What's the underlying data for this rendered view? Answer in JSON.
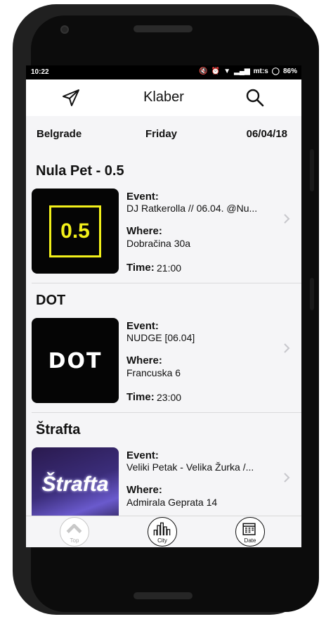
{
  "status_bar": {
    "time": "10:22",
    "carrier": "mt:s",
    "battery": "86%"
  },
  "header": {
    "title": "Klaber",
    "left_icon": "send-icon",
    "right_icon": "search-icon"
  },
  "filters": {
    "city": "Belgrade",
    "day": "Friday",
    "date": "06/04/18"
  },
  "labels": {
    "event": "Event:",
    "where": "Where:",
    "time": "Time:"
  },
  "venues": [
    {
      "name": "Nula Pet - 0.5",
      "logo_text": "0.5",
      "event": "DJ Ratkerolla // 06.04. @Nu...",
      "where": "Dobračina 30a",
      "time": "21:00"
    },
    {
      "name": "DOT",
      "logo_text": "DOT",
      "event": "NUDGE [06.04]",
      "where": "Francuska 6",
      "time": "23:00"
    },
    {
      "name": "Štrafta",
      "logo_text": "Štrafta",
      "event": "Veliki Petak - Velika Žurka /...",
      "where": "Admirala Geprata 14"
    }
  ],
  "tabbar": [
    {
      "label": "Top",
      "icon": "arrow-up-icon"
    },
    {
      "label": "City",
      "icon": "city-icon"
    },
    {
      "label": "Date",
      "icon": "calendar-icon"
    }
  ],
  "colors": {
    "logo_yellow": "#f2f01a",
    "background": "#f5f5f7"
  }
}
